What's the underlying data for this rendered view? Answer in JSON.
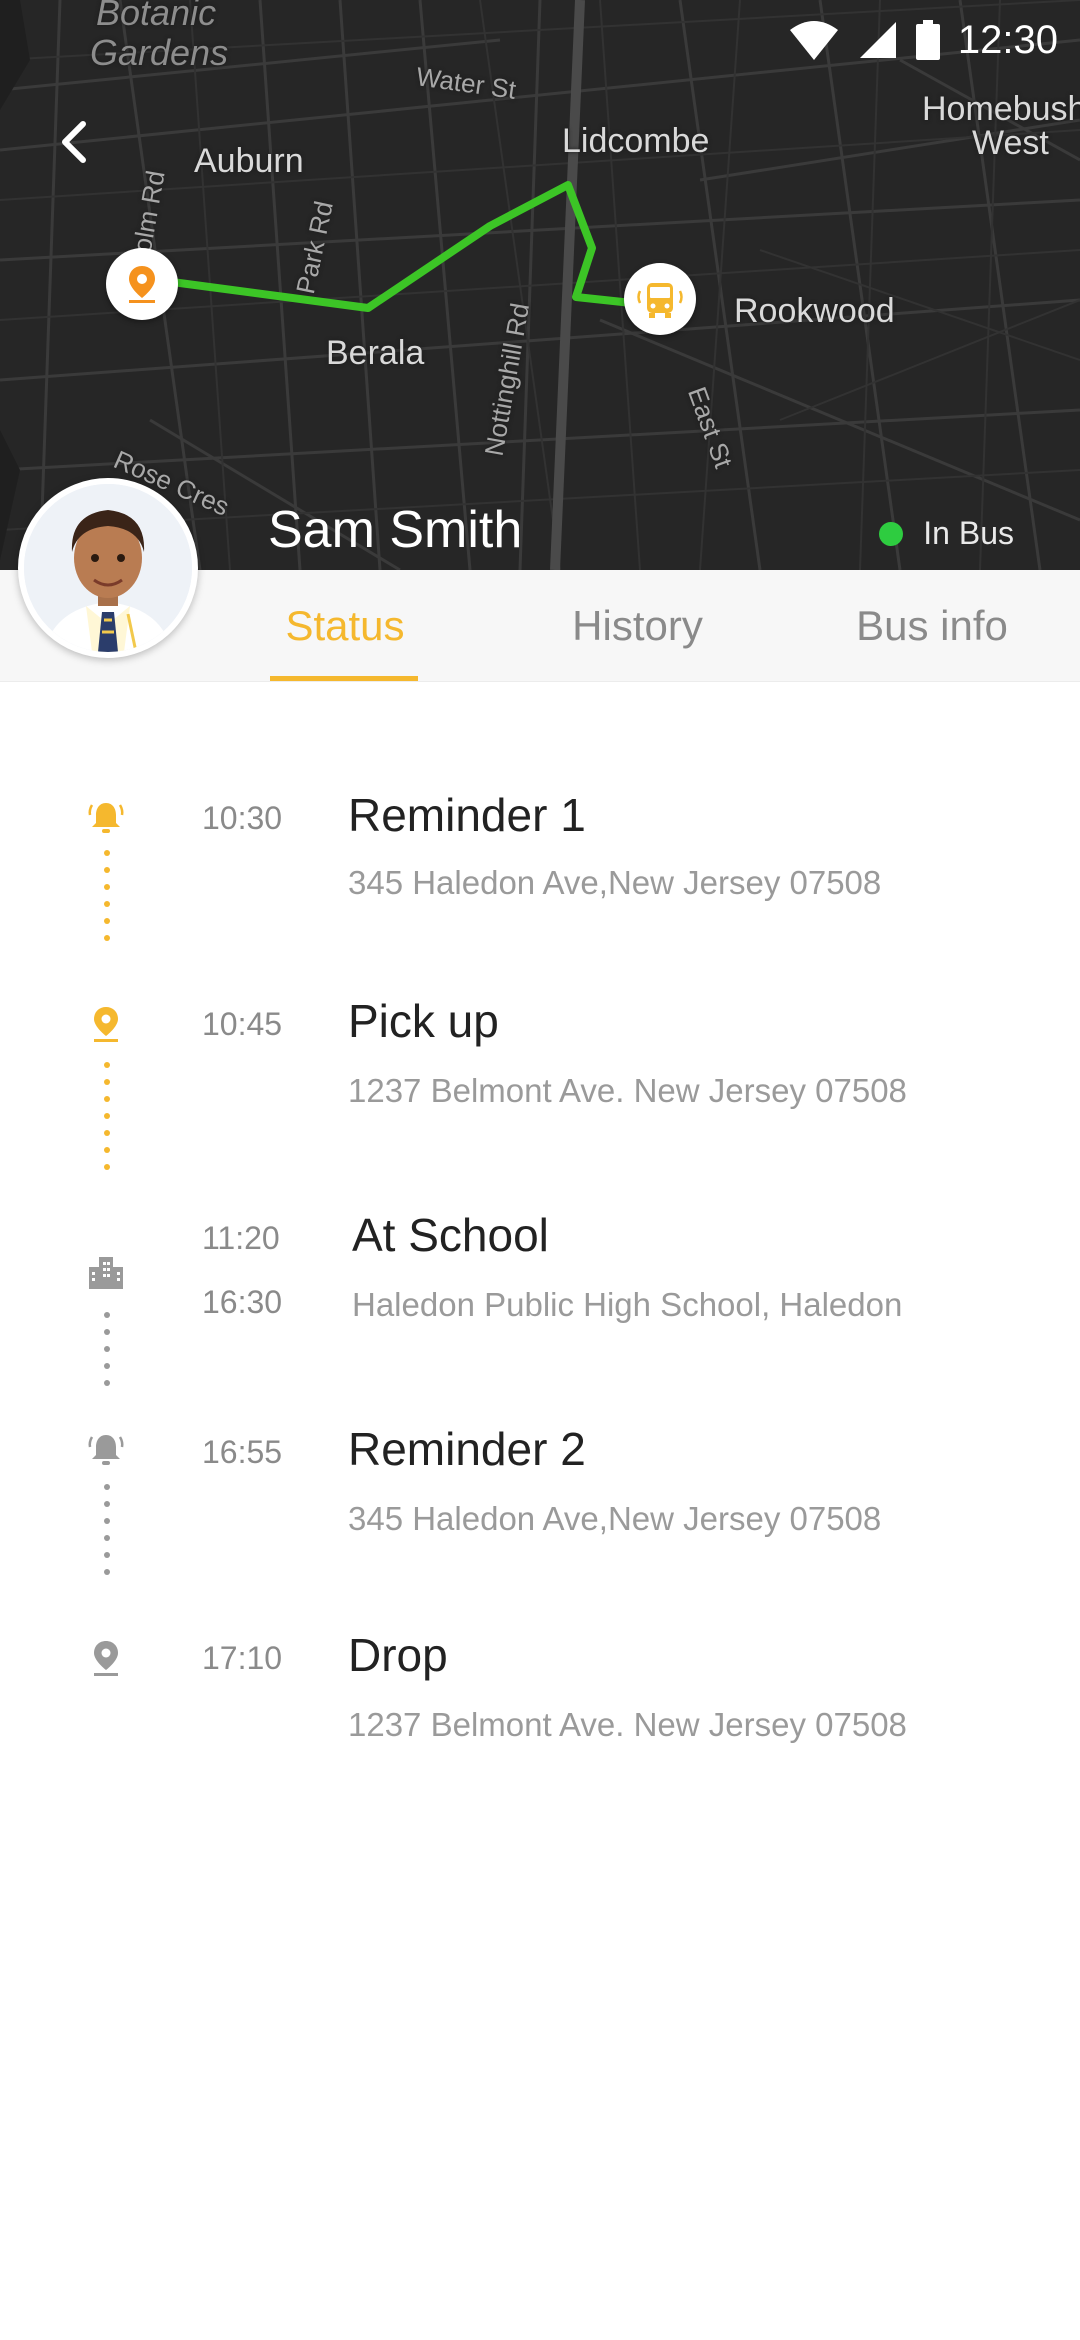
{
  "status_bar": {
    "time": "12:30"
  },
  "map": {
    "labels": {
      "botanic": "Botanic",
      "gardens": "Gardens",
      "water_st": "Water St",
      "auburn": "Auburn",
      "lidcombe": "Lidcombe",
      "homebush": "Homebush",
      "west": "West",
      "berala": "Berala",
      "rookwood": "Rookwood",
      "park_rd": "Park Rd",
      "nottinghill_rd": "Nottinghill Rd",
      "east_st": "East St",
      "rose_cres": "Rose Cres",
      "olm_rd": "olm Rd"
    },
    "route_color": "#3cc526"
  },
  "profile": {
    "name": "Sam Smith",
    "status": "In Bus",
    "status_color": "#2ecc40"
  },
  "tabs": [
    {
      "label": "Status",
      "active": true
    },
    {
      "label": "History",
      "active": false
    },
    {
      "label": "Bus info",
      "active": false
    }
  ],
  "accent_color": "#f5b82e",
  "timeline": [
    {
      "icon": "bell-icon",
      "time": "10:30",
      "title": "Reminder 1",
      "address": "345 Haledon Ave,New Jersey 07508",
      "done": true
    },
    {
      "icon": "location-pin-icon",
      "time": "10:45",
      "title": "Pick up",
      "address": "1237 Belmont Ave. New Jersey 07508",
      "done": true
    },
    {
      "icon": "building-icon",
      "time": "11:20",
      "time2": "16:30",
      "title": "At School",
      "address": "Haledon Public High School, Haledon",
      "done": false
    },
    {
      "icon": "bell-icon",
      "time": "16:55",
      "title": "Reminder 2",
      "address": "345 Haledon Ave,New Jersey 07508",
      "done": false
    },
    {
      "icon": "location-pin-icon",
      "time": "17:10",
      "title": "Drop",
      "address": "1237 Belmont Ave. New Jersey 07508",
      "done": false
    }
  ]
}
